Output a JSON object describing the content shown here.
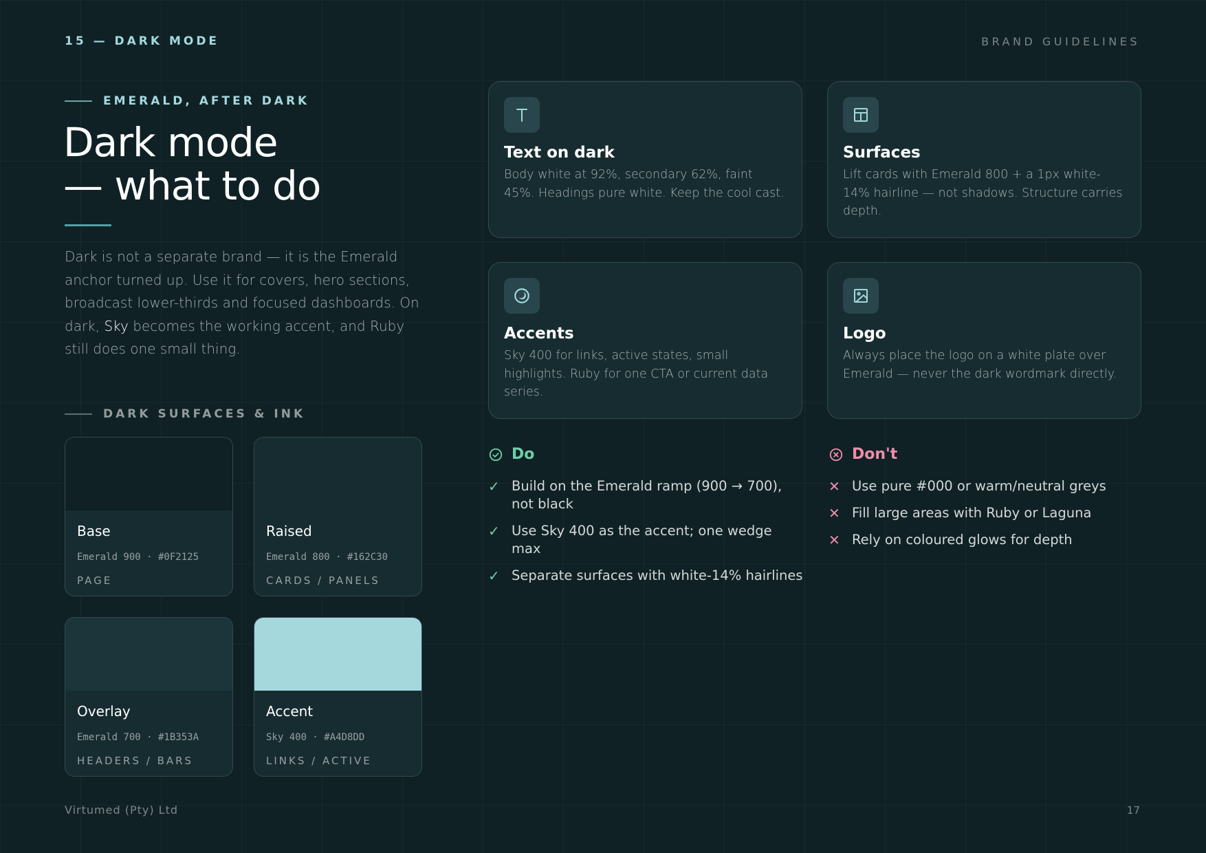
{
  "header": {
    "section": "15 — DARK MODE",
    "doc_title": "BRAND GUIDELINES"
  },
  "hero": {
    "eyebrow": "EMERALD, AFTER DARK",
    "title_line1": "Dark mode",
    "title_line2": "— what to do",
    "intro_part1": "Dark is not a separate brand — it is the Emerald anchor turned up. Use it for covers, hero sections, broadcast lower-thirds and focused dashboards. On dark, ",
    "intro_strong": "Sky",
    "intro_part2": " becomes the working accent, and Ruby still does one small thing."
  },
  "surfaces": {
    "heading": "DARK SURFACES & INK",
    "items": [
      {
        "name": "Base",
        "code": "Emerald 900 · #0F2125",
        "use": "PAGE",
        "color": "#0F2125"
      },
      {
        "name": "Raised",
        "code": "Emerald 800 · #162C30",
        "use": "CARDS / PANELS",
        "color": "#162C30"
      },
      {
        "name": "Overlay",
        "code": "Emerald 700 · #1B353A",
        "use": "HEADERS / BARS",
        "color": "#1B353A"
      },
      {
        "name": "Accent",
        "code": "Sky 400 · #A4D8DD",
        "use": "LINKS / ACTIVE",
        "color": "#A4D8DD"
      }
    ]
  },
  "cards": [
    {
      "icon": "text-icon",
      "title": "Text on dark",
      "body": "Body white at 92%, secondary 62%, faint 45%. Headings pure white. Keep the cool cast."
    },
    {
      "icon": "layout-panel-icon",
      "title": "Surfaces",
      "body": "Lift cards with Emerald 800 + a 1px white-14% hairline — not shadows. Structure carries depth."
    },
    {
      "icon": "moon-circle-icon",
      "title": "Accents",
      "body": "Sky 400 for links, active states, small highlights. Ruby for one CTA or current data series."
    },
    {
      "icon": "image-icon",
      "title": "Logo",
      "body": "Always place the logo on a white plate over Emerald — never the dark wordmark directly."
    }
  ],
  "do": {
    "title": "Do",
    "items": [
      "Build on the Emerald ramp (900 → 700), not black",
      "Use Sky 400 as the accent; one wedge max",
      "Separate surfaces with white-14% hairlines"
    ]
  },
  "dont": {
    "title": "Don't",
    "items": [
      "Use pure #000 or warm/neutral greys",
      "Fill large areas with Ruby or Laguna",
      "Rely on coloured glows for depth"
    ]
  },
  "footer": {
    "company": "Virtumed (Pty) Ltd",
    "page_number": "17"
  },
  "colors": {
    "page_bg": "#0F2125",
    "card_bg": "#162C30",
    "accent_sky": "#A4D8DD",
    "do_green": "#6FCFA8",
    "dont_ruby": "#EE8EA8"
  }
}
